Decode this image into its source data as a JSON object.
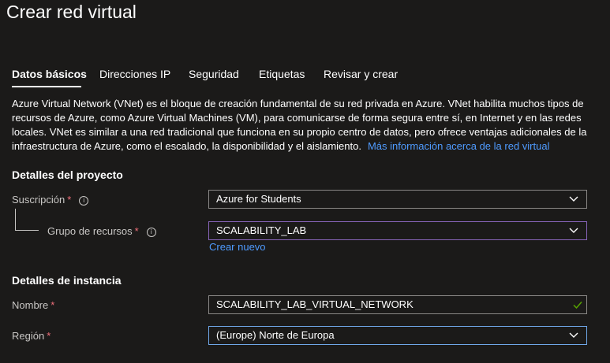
{
  "page": {
    "title": "Crear red virtual"
  },
  "tabs": [
    {
      "label": "Datos básicos",
      "active": true
    },
    {
      "label": "Direcciones IP",
      "active": false
    },
    {
      "label": "Seguridad",
      "active": false
    },
    {
      "label": "Etiquetas",
      "active": false
    },
    {
      "label": "Revisar y crear",
      "active": false
    }
  ],
  "description": {
    "text": "Azure Virtual Network (VNet) es el bloque de creación fundamental de su red privada en Azure. VNet habilita muchos tipos de recursos de Azure, como Azure Virtual Machines (VM), para comunicarse de forma segura entre sí, en Internet y en las redes locales. VNet es similar a una red tradicional que funciona en su propio centro de datos, pero ofrece ventajas adicionales de la infraestructura de Azure, como el escalado, la disponibilidad y el aislamiento.",
    "link": "Más información acerca de la red virtual"
  },
  "project": {
    "heading": "Detalles del proyecto",
    "subscription": {
      "label": "Suscripción",
      "required": "*",
      "value": "Azure for Students"
    },
    "resource_group": {
      "label": "Grupo de recursos",
      "required": "*",
      "value": "SCALABILITY_LAB",
      "create_new": "Crear nuevo"
    }
  },
  "instance": {
    "heading": "Detalles de instancia",
    "name": {
      "label": "Nombre",
      "required": "*",
      "value": "SCALABILITY_LAB_VIRTUAL_NETWORK"
    },
    "region": {
      "label": "Región",
      "required": "*",
      "value": "(Europe) Norte de Europa"
    }
  },
  "icons": {
    "info": "info-icon",
    "dropdown": "chevron-down-icon",
    "valid": "checkmark-icon"
  },
  "colors": {
    "background": "#1b1a19",
    "link": "#4f9bff",
    "required": "#f1707b",
    "focus_border": "#8764b8",
    "active_border": "#6fa7e8",
    "valid": "#57a300"
  }
}
